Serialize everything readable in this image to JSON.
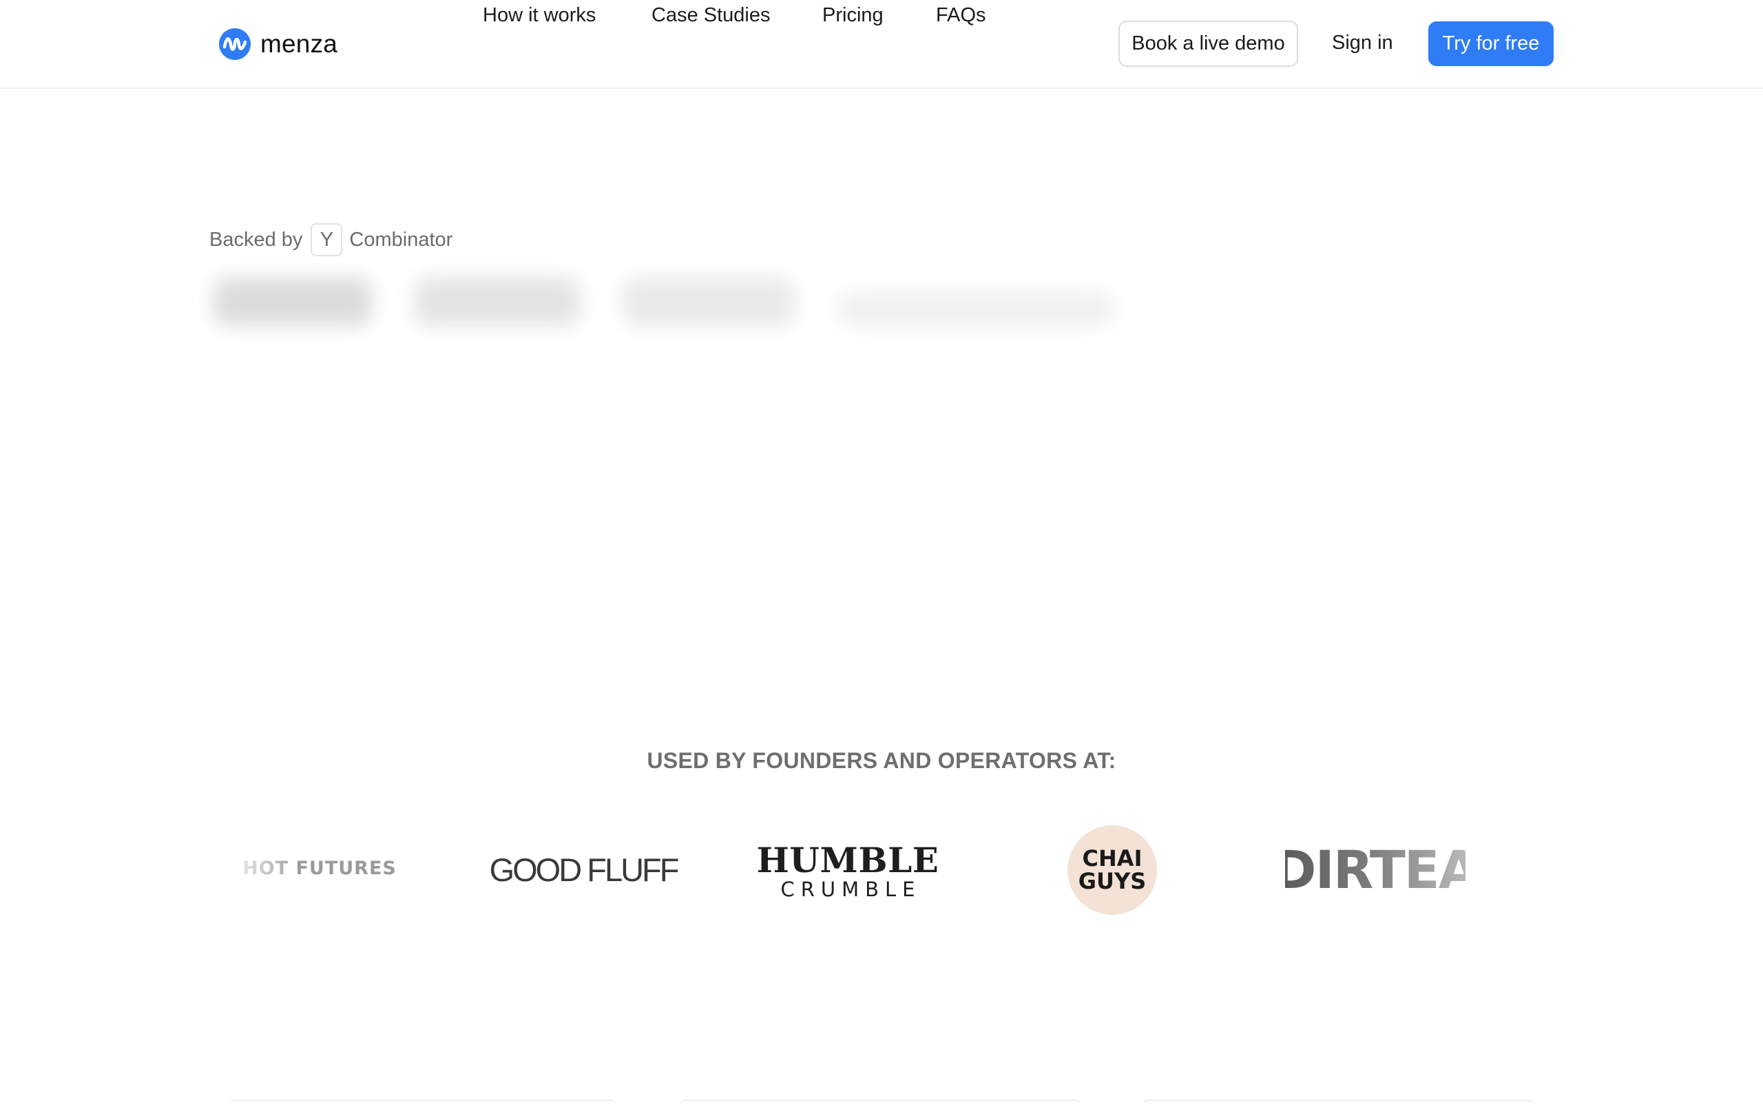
{
  "brand": {
    "name": "menza",
    "accent_color": "#2f7cf6",
    "logo_icon": "menza-wave-icon"
  },
  "nav": {
    "items": [
      {
        "label": "How it works"
      },
      {
        "label": "Case Studies"
      },
      {
        "label": "Pricing"
      },
      {
        "label": "FAQs"
      }
    ],
    "demo_label": "Book a live demo",
    "signin_label": "Sign in",
    "try_label": "Try for free"
  },
  "hero": {
    "backed_prefix": "Backed by",
    "yc_letter": "Y",
    "backed_suffix": "Combinator"
  },
  "social_proof": {
    "heading": "USED BY FOUNDERS AND OPERATORS AT:",
    "logos": [
      {
        "name": "HOT FUTURES"
      },
      {
        "name": "GOOD FLUFF"
      },
      {
        "name_top": "HUMBLE",
        "name_bottom": "CRUMBLE"
      },
      {
        "name_top": "CHAI",
        "name_bottom": "GUYS",
        "badge_color": "#f3e2d5"
      },
      {
        "name": "DIRTEA"
      }
    ]
  }
}
